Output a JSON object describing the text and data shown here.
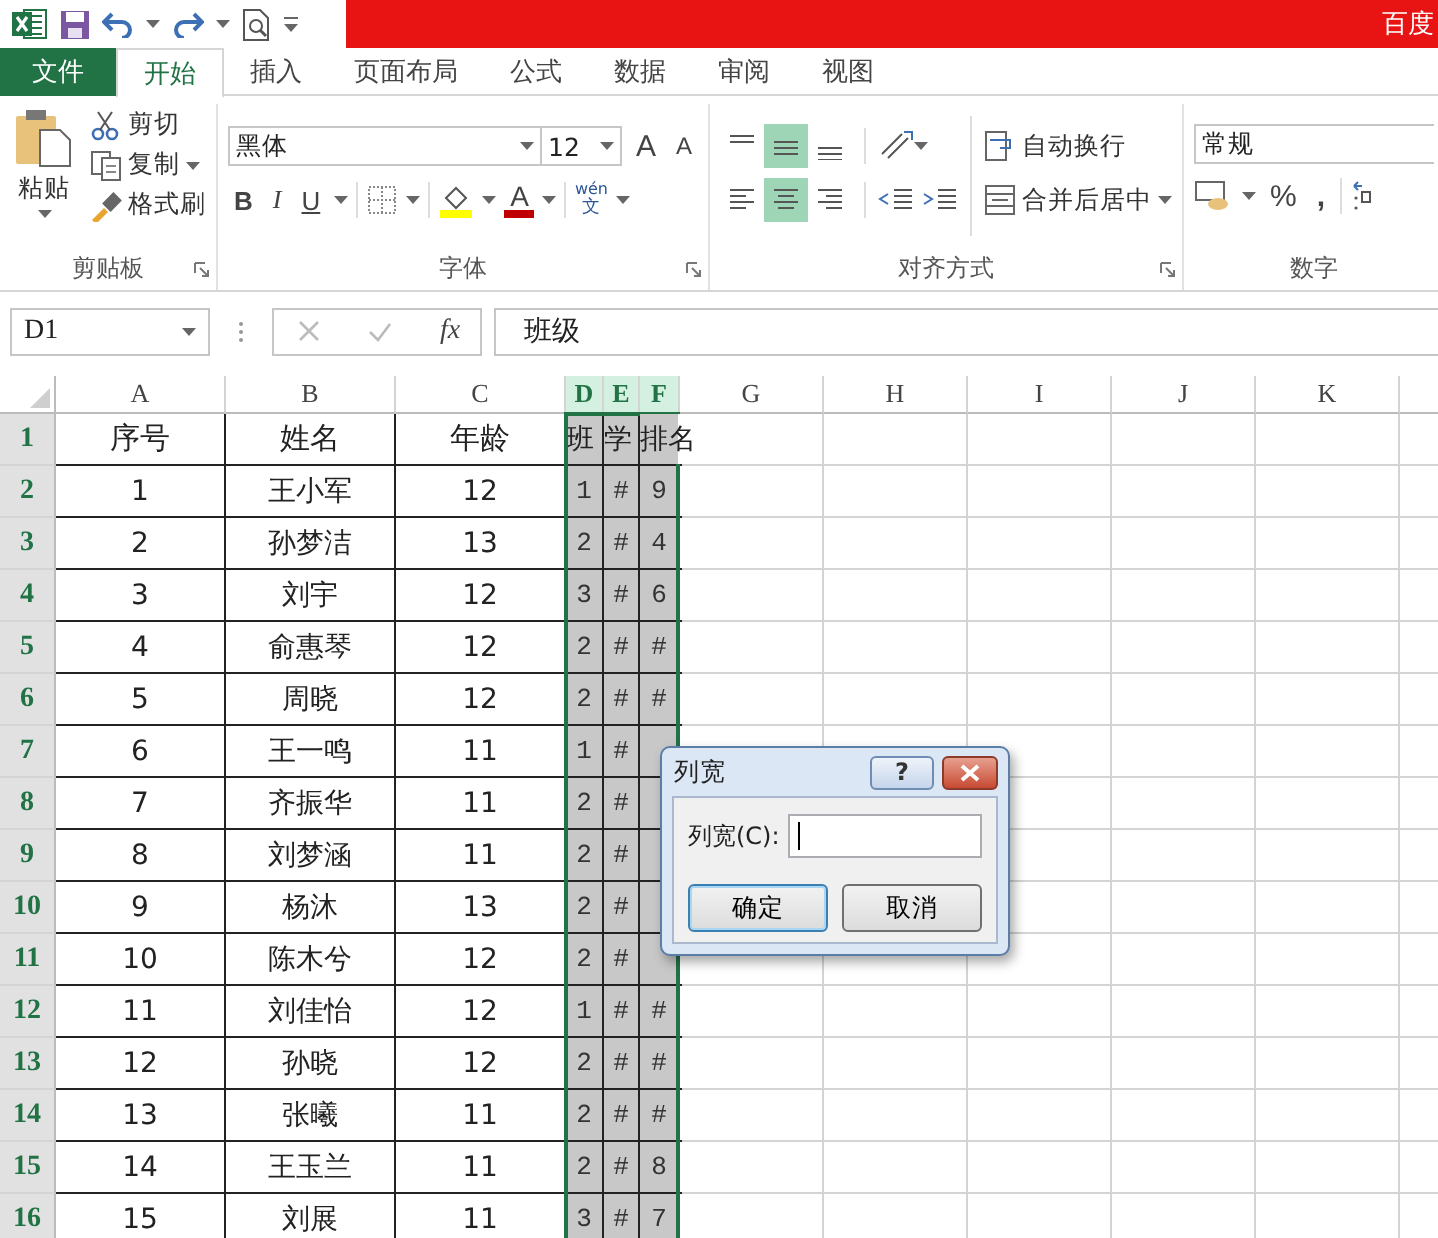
{
  "title_bar": {
    "text": "百度"
  },
  "tabs": [
    {
      "label": "文件",
      "kind": "file",
      "selected": false
    },
    {
      "label": "开始",
      "kind": "tab",
      "selected": true
    },
    {
      "label": "插入",
      "kind": "tab",
      "selected": false
    },
    {
      "label": "页面布局",
      "kind": "tab",
      "selected": false
    },
    {
      "label": "公式",
      "kind": "tab",
      "selected": false
    },
    {
      "label": "数据",
      "kind": "tab",
      "selected": false
    },
    {
      "label": "审阅",
      "kind": "tab",
      "selected": false
    },
    {
      "label": "视图",
      "kind": "tab",
      "selected": false
    }
  ],
  "ribbon": {
    "clipboard": {
      "title": "剪贴板",
      "paste": "粘贴",
      "cut": "剪切",
      "copy": "复制",
      "format_painter": "格式刷"
    },
    "font": {
      "title": "字体",
      "font_name": "黑体",
      "font_size": "12",
      "grow": "A",
      "shrink": "A",
      "bold": "B",
      "italic": "I",
      "underline": "U",
      "font_color": "A",
      "phonetic_top": "wén",
      "phonetic_bottom": "文"
    },
    "alignment": {
      "title": "对齐方式",
      "vertical_align": [
        {
          "kind": "top",
          "selected": false
        },
        {
          "kind": "middle",
          "selected": true
        },
        {
          "kind": "bottom",
          "selected": false
        }
      ],
      "horizontal_align": [
        {
          "kind": "left",
          "selected": false
        },
        {
          "kind": "center",
          "selected": true
        },
        {
          "kind": "right",
          "selected": false
        }
      ],
      "wrap_text": "自动换行",
      "merge_center": "合并后居中"
    },
    "number": {
      "title": "数字",
      "format": "常规",
      "percent": "%",
      "comma": ","
    }
  },
  "formula_bar": {
    "name_box": "D1",
    "fx": "fx",
    "value": "班级"
  },
  "sheet": {
    "columns": [
      {
        "label": "A",
        "selected": false
      },
      {
        "label": "B",
        "selected": false
      },
      {
        "label": "C",
        "selected": false
      },
      {
        "label": "D",
        "selected": true
      },
      {
        "label": "E",
        "selected": true
      },
      {
        "label": "F",
        "selected": true
      },
      {
        "label": "G",
        "selected": false
      },
      {
        "label": "H",
        "selected": false
      },
      {
        "label": "I",
        "selected": false
      },
      {
        "label": "J",
        "selected": false
      },
      {
        "label": "K",
        "selected": false
      }
    ],
    "rows": [
      {
        "number": "1",
        "selected": true,
        "cells": [
          "序号",
          "姓名",
          "年龄",
          "班",
          "学",
          "排名"
        ]
      },
      {
        "number": "2",
        "selected": true,
        "cells": [
          "1",
          "王小军",
          "12",
          "1",
          "#",
          "9"
        ]
      },
      {
        "number": "3",
        "selected": true,
        "cells": [
          "2",
          "孙梦洁",
          "13",
          "2",
          "#",
          "4"
        ]
      },
      {
        "number": "4",
        "selected": true,
        "cells": [
          "3",
          "刘宇",
          "12",
          "3",
          "#",
          "6"
        ]
      },
      {
        "number": "5",
        "selected": true,
        "cells": [
          "4",
          "俞惠琴",
          "12",
          "2",
          "#",
          "#"
        ]
      },
      {
        "number": "6",
        "selected": true,
        "cells": [
          "5",
          "周晓",
          "12",
          "2",
          "#",
          "#"
        ]
      },
      {
        "number": "7",
        "selected": true,
        "cells": [
          "6",
          "王一鸣",
          "11",
          "1",
          "#"
        ]
      },
      {
        "number": "8",
        "selected": true,
        "cells": [
          "7",
          "齐振华",
          "11",
          "2",
          "#"
        ]
      },
      {
        "number": "9",
        "selected": true,
        "cells": [
          "8",
          "刘梦涵",
          "11",
          "2",
          "#"
        ]
      },
      {
        "number": "10",
        "selected": true,
        "cells": [
          "9",
          "杨沐",
          "13",
          "2",
          "#"
        ]
      },
      {
        "number": "11",
        "selected": true,
        "cells": [
          "10",
          "陈木兮",
          "12",
          "2",
          "#"
        ]
      },
      {
        "number": "12",
        "selected": true,
        "cells": [
          "11",
          "刘佳怡",
          "12",
          "1",
          "#",
          "#"
        ]
      },
      {
        "number": "13",
        "selected": true,
        "cells": [
          "12",
          "孙晓",
          "12",
          "2",
          "#",
          "#"
        ]
      },
      {
        "number": "14",
        "selected": true,
        "cells": [
          "13",
          "张曦",
          "11",
          "2",
          "#",
          "#"
        ]
      },
      {
        "number": "15",
        "selected": true,
        "cells": [
          "14",
          "王玉兰",
          "11",
          "2",
          "#",
          "8"
        ]
      },
      {
        "number": "16",
        "selected": true,
        "cells": [
          "15",
          "刘展",
          "11",
          "3",
          "#",
          "7"
        ]
      }
    ]
  },
  "dialog": {
    "title": "列宽",
    "help": "?",
    "label": "列宽(C):",
    "ok": "确定",
    "cancel": "取消"
  }
}
